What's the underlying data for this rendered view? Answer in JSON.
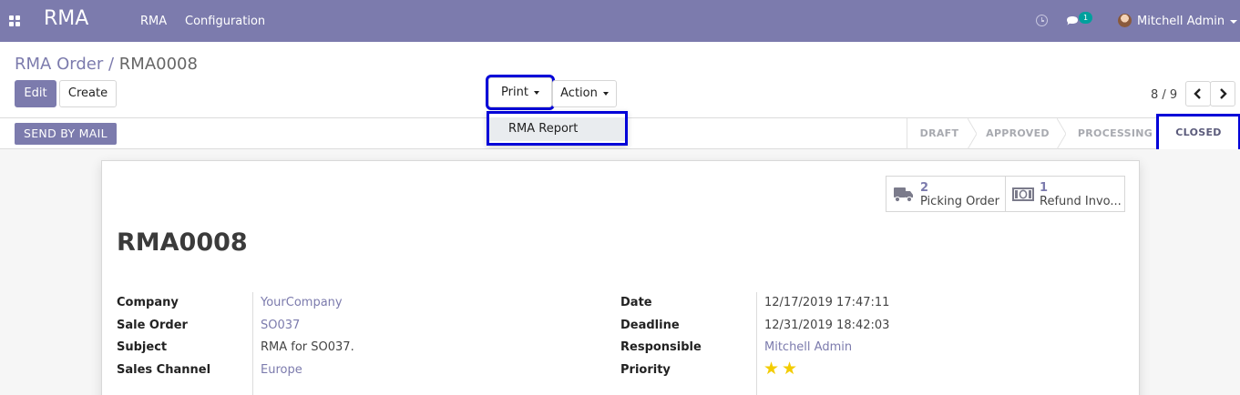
{
  "navbar": {
    "app_name": "RMA",
    "menu_items": [
      "RMA",
      "Configuration"
    ],
    "chat_badge": "1",
    "user_name": "Mitchell Admin"
  },
  "breadcrumb": {
    "parent": "RMA Order",
    "separator": "/",
    "current": "RMA0008"
  },
  "toolbar": {
    "edit_label": "Edit",
    "create_label": "Create",
    "print_label": "Print",
    "action_label": "Action"
  },
  "print_menu": {
    "items": [
      "RMA Report"
    ]
  },
  "pager": {
    "value": "8 / 9"
  },
  "statusbar": {
    "send_mail_label": "SEND BY MAIL",
    "stages": [
      "DRAFT",
      "APPROVED",
      "PROCESSING",
      "CLOSED"
    ],
    "current_stage": "CLOSED"
  },
  "smart_buttons": [
    {
      "count": "2",
      "label": "Picking Order",
      "icon": "truck-icon"
    },
    {
      "count": "1",
      "label": "Refund Invo...",
      "icon": "money-icon"
    }
  ],
  "record": {
    "name": "RMA0008",
    "left_fields": [
      {
        "label": "Company",
        "value": "YourCompany"
      },
      {
        "label": "Sale Order",
        "value": "SO037"
      },
      {
        "label": "Subject",
        "value": "RMA for SO037."
      },
      {
        "label": "Sales Channel",
        "value": "Europe"
      }
    ],
    "right_fields": [
      {
        "label": "Date",
        "value": "12/17/2019 17:47:11"
      },
      {
        "label": "Deadline",
        "value": "12/31/2019 18:42:03"
      },
      {
        "label": "Responsible",
        "value": "Mitchell Admin"
      },
      {
        "label": "Priority",
        "value": ""
      }
    ],
    "priority_stars": 2
  },
  "colors": {
    "brand": "#7c7bad",
    "highlight": "#0000d8",
    "star": "#f3cc00"
  }
}
